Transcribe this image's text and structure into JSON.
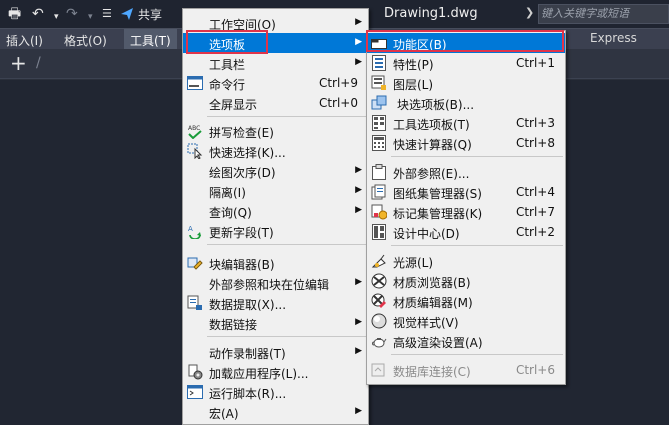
{
  "titlebar": {
    "share_label": "共享",
    "doc_title": "Drawing1.dwg",
    "search_placeholder": "键入关键字或短语"
  },
  "menubar": {
    "items": [
      {
        "label": "插入(I)"
      },
      {
        "label": "格式(O)"
      },
      {
        "label": "工具(T)"
      }
    ],
    "ribbon_tab_express": "Express"
  },
  "tools_menu": {
    "items": [
      {
        "label": "工作空间(O)",
        "submenu": true
      },
      {
        "label": "选项板",
        "submenu": true,
        "highlighted": true
      },
      {
        "label": "工具栏",
        "submenu": true
      },
      {
        "label": "命令行",
        "shortcut": "Ctrl+9"
      },
      {
        "label": "全屏显示",
        "shortcut": "Ctrl+0"
      },
      {
        "label": "拼写检查(E)"
      },
      {
        "label": "快速选择(K)..."
      },
      {
        "label": "绘图次序(D)",
        "submenu": true
      },
      {
        "label": "隔离(I)",
        "submenu": true
      },
      {
        "label": "查询(Q)",
        "submenu": true
      },
      {
        "label": "更新字段(T)"
      },
      {
        "label": "块编辑器(B)"
      },
      {
        "label": "外部参照和块在位编辑",
        "submenu": true
      },
      {
        "label": "数据提取(X)..."
      },
      {
        "label": "数据链接",
        "submenu": true
      },
      {
        "label": "动作录制器(T)",
        "submenu": true
      },
      {
        "label": "加载应用程序(L)..."
      },
      {
        "label": "运行脚本(R)..."
      },
      {
        "label": "宏(A)",
        "submenu": true
      }
    ]
  },
  "palettes_menu": {
    "items": [
      {
        "label": "功能区(B)",
        "highlighted": true
      },
      {
        "label": "特性(P)",
        "shortcut": "Ctrl+1"
      },
      {
        "label": "图层(L)"
      },
      {
        "label": "块选项板(B)..."
      },
      {
        "label": "工具选项板(T)",
        "shortcut": "Ctrl+3"
      },
      {
        "label": "快速计算器(Q)",
        "shortcut": "Ctrl+8"
      },
      {
        "label": "外部参照(E)..."
      },
      {
        "label": "图纸集管理器(S)",
        "shortcut": "Ctrl+4"
      },
      {
        "label": "标记集管理器(K)",
        "shortcut": "Ctrl+7"
      },
      {
        "label": "设计中心(D)",
        "shortcut": "Ctrl+2"
      },
      {
        "label": "光源(L)"
      },
      {
        "label": "材质浏览器(B)"
      },
      {
        "label": "材质编辑器(M)"
      },
      {
        "label": "视觉样式(V)"
      },
      {
        "label": "高级渲染设置(A)"
      },
      {
        "label": "数据库连接(C)",
        "shortcut": "Ctrl+6",
        "disabled": true
      }
    ]
  },
  "colors": {
    "highlight": "#0078d7",
    "annotation_box": "#e0344a"
  }
}
